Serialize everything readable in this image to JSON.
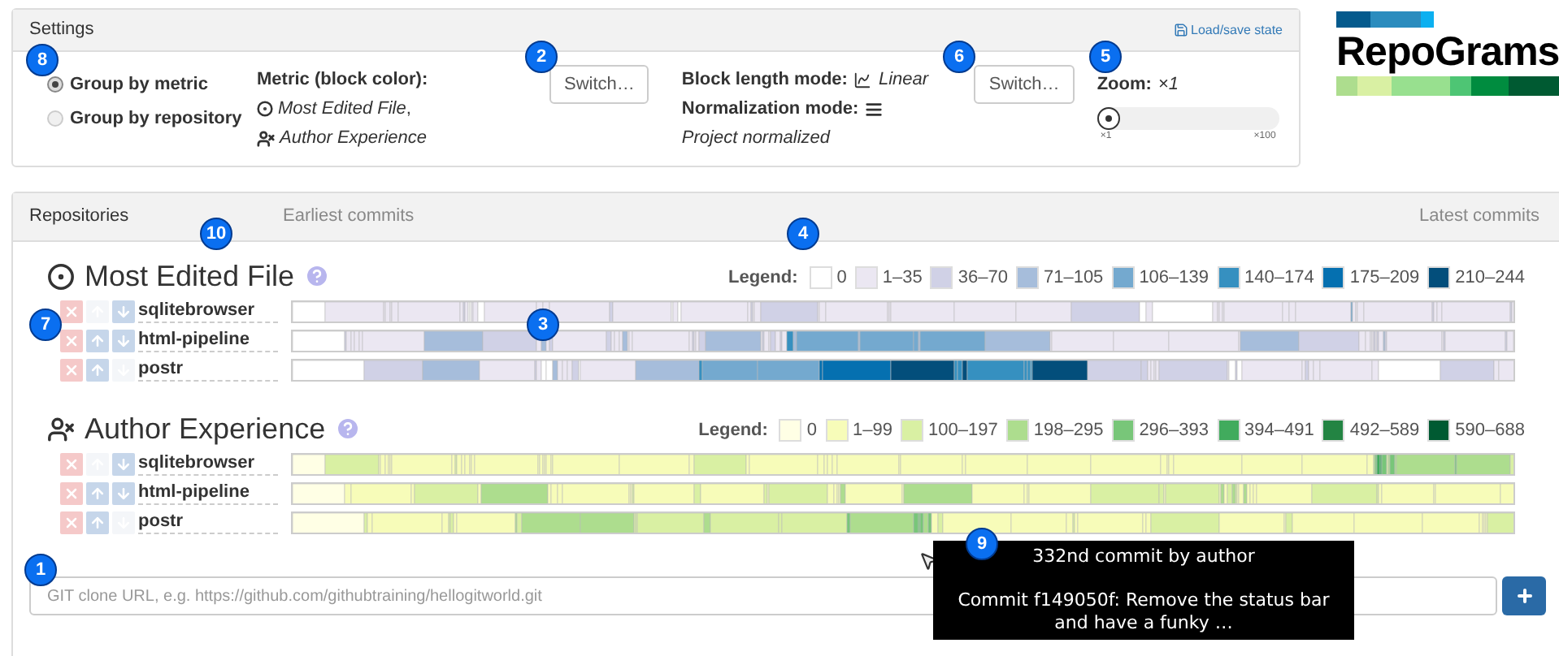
{
  "settings": {
    "title": "Settings",
    "load_save": "Load/save state",
    "grouping": [
      {
        "label": "Group by metric",
        "selected": true
      },
      {
        "label": "Group by repository",
        "selected": false
      }
    ],
    "metric": {
      "label": "Metric (block color):",
      "values": [
        "Most Edited File",
        "Author Experience"
      ],
      "separator": ","
    },
    "switch_buttons": [
      "Switch…",
      "Switch…"
    ],
    "block_length": {
      "label": "Block length mode:",
      "value": "Linear"
    },
    "normalization": {
      "label": "Normalization mode:",
      "value": "Project normalized"
    },
    "zoom": {
      "label": "Zoom:",
      "value": "×1",
      "level": 0,
      "min": "×1",
      "max": "×100"
    }
  },
  "logo": {
    "text": "RepoGrams"
  },
  "repositories": {
    "header": [
      "Repositories",
      "Earliest commits",
      "Latest commits"
    ],
    "metrics": [
      {
        "kind": "file",
        "title": "Most Edited File",
        "legend_label": "Legend:",
        "legend": [
          {
            "label": "0",
            "color": "#ffffff"
          },
          {
            "label": "1–35",
            "color": "#ebe7f2"
          },
          {
            "label": "36–70",
            "color": "#d0d1e6"
          },
          {
            "label": "71–105",
            "color": "#a6bddb"
          },
          {
            "label": "106–139",
            "color": "#74a9cf"
          },
          {
            "label": "140–174",
            "color": "#3690c0"
          },
          {
            "label": "175–209",
            "color": "#0570b0"
          },
          {
            "label": "210–244",
            "color": "#034e7b"
          }
        ],
        "repos": [
          {
            "name": "sqlitebrowser",
            "up_disabled": true,
            "down_disabled": false
          },
          {
            "name": "html-pipeline",
            "up_disabled": false,
            "down_disabled": false
          },
          {
            "name": "postr",
            "up_disabled": false,
            "down_disabled": true
          }
        ]
      },
      {
        "kind": "author",
        "title": "Author Experience",
        "legend_label": "Legend:",
        "legend": [
          {
            "label": "0",
            "color": "#ffffe5"
          },
          {
            "label": "1–99",
            "color": "#f7fcb9"
          },
          {
            "label": "100–197",
            "color": "#d9f0a3"
          },
          {
            "label": "198–295",
            "color": "#addd8e"
          },
          {
            "label": "296–393",
            "color": "#78c679"
          },
          {
            "label": "394–491",
            "color": "#41ab5d"
          },
          {
            "label": "492–589",
            "color": "#238443"
          },
          {
            "label": "590–688",
            "color": "#005a32"
          }
        ],
        "repos": [
          {
            "name": "sqlitebrowser",
            "up_disabled": true,
            "down_disabled": false
          },
          {
            "name": "html-pipeline",
            "up_disabled": false,
            "down_disabled": false
          },
          {
            "name": "postr",
            "up_disabled": false,
            "down_disabled": true
          }
        ]
      }
    ],
    "url_placeholder": "GIT clone URL, e.g. https://github.com/githubtraining/hellogitworld.git"
  },
  "tooltip": {
    "lines": [
      "332nd commit by author",
      "Commit f149050f: Remove the status bar and have a funky …"
    ]
  },
  "callouts": [
    "8",
    "2",
    "6",
    "5",
    "10",
    "4",
    "7",
    "3",
    "1",
    "9"
  ]
}
